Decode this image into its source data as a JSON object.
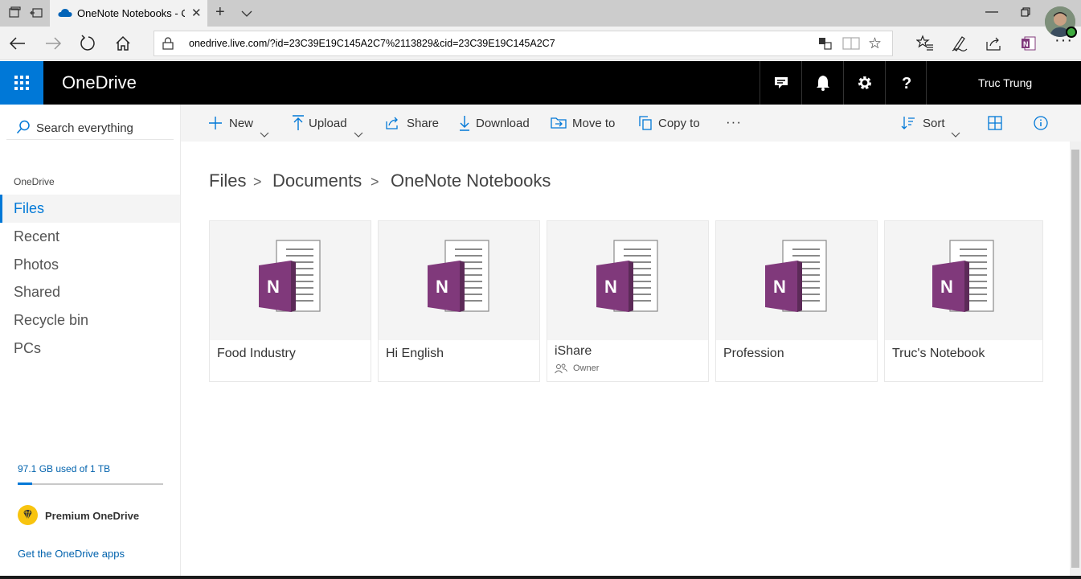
{
  "browser": {
    "tab_title": "OneNote Notebooks - OneDrive",
    "url": "onedrive.live.com/?id=23C39E19C145A2C7%2113829&cid=23C39E19C145A2C7"
  },
  "header": {
    "brand": "OneDrive",
    "user_name": "Truc Trung"
  },
  "leftnav": {
    "search_placeholder": "Search everything",
    "section": "OneDrive",
    "items": [
      {
        "label": "Files",
        "active": true
      },
      {
        "label": "Recent",
        "active": false
      },
      {
        "label": "Photos",
        "active": false
      },
      {
        "label": "Shared",
        "active": false
      },
      {
        "label": "Recycle bin",
        "active": false
      },
      {
        "label": "PCs",
        "active": false
      }
    ],
    "quota_text": "97.1 GB used of 1 TB",
    "quota_fraction": 0.0971,
    "premium": "Premium OneDrive",
    "apps_link": "Get the OneDrive apps"
  },
  "commandbar": {
    "new": "New",
    "upload": "Upload",
    "share": "Share",
    "download": "Download",
    "move_to": "Move to",
    "copy_to": "Copy to",
    "more": "···",
    "sort": "Sort"
  },
  "breadcrumb": [
    "Files",
    "Documents",
    "OneNote Notebooks"
  ],
  "breadcrumb_sep": ">",
  "notebooks": [
    {
      "name": "Food Industry",
      "meta": ""
    },
    {
      "name": "Hi English",
      "meta": ""
    },
    {
      "name": "iShare",
      "meta": "Owner"
    },
    {
      "name": "Profession",
      "meta": ""
    },
    {
      "name": "Truc's Notebook",
      "meta": ""
    }
  ],
  "colors": {
    "accent": "#0078d7",
    "onenote": "#80397b",
    "header_bg": "#000000"
  }
}
